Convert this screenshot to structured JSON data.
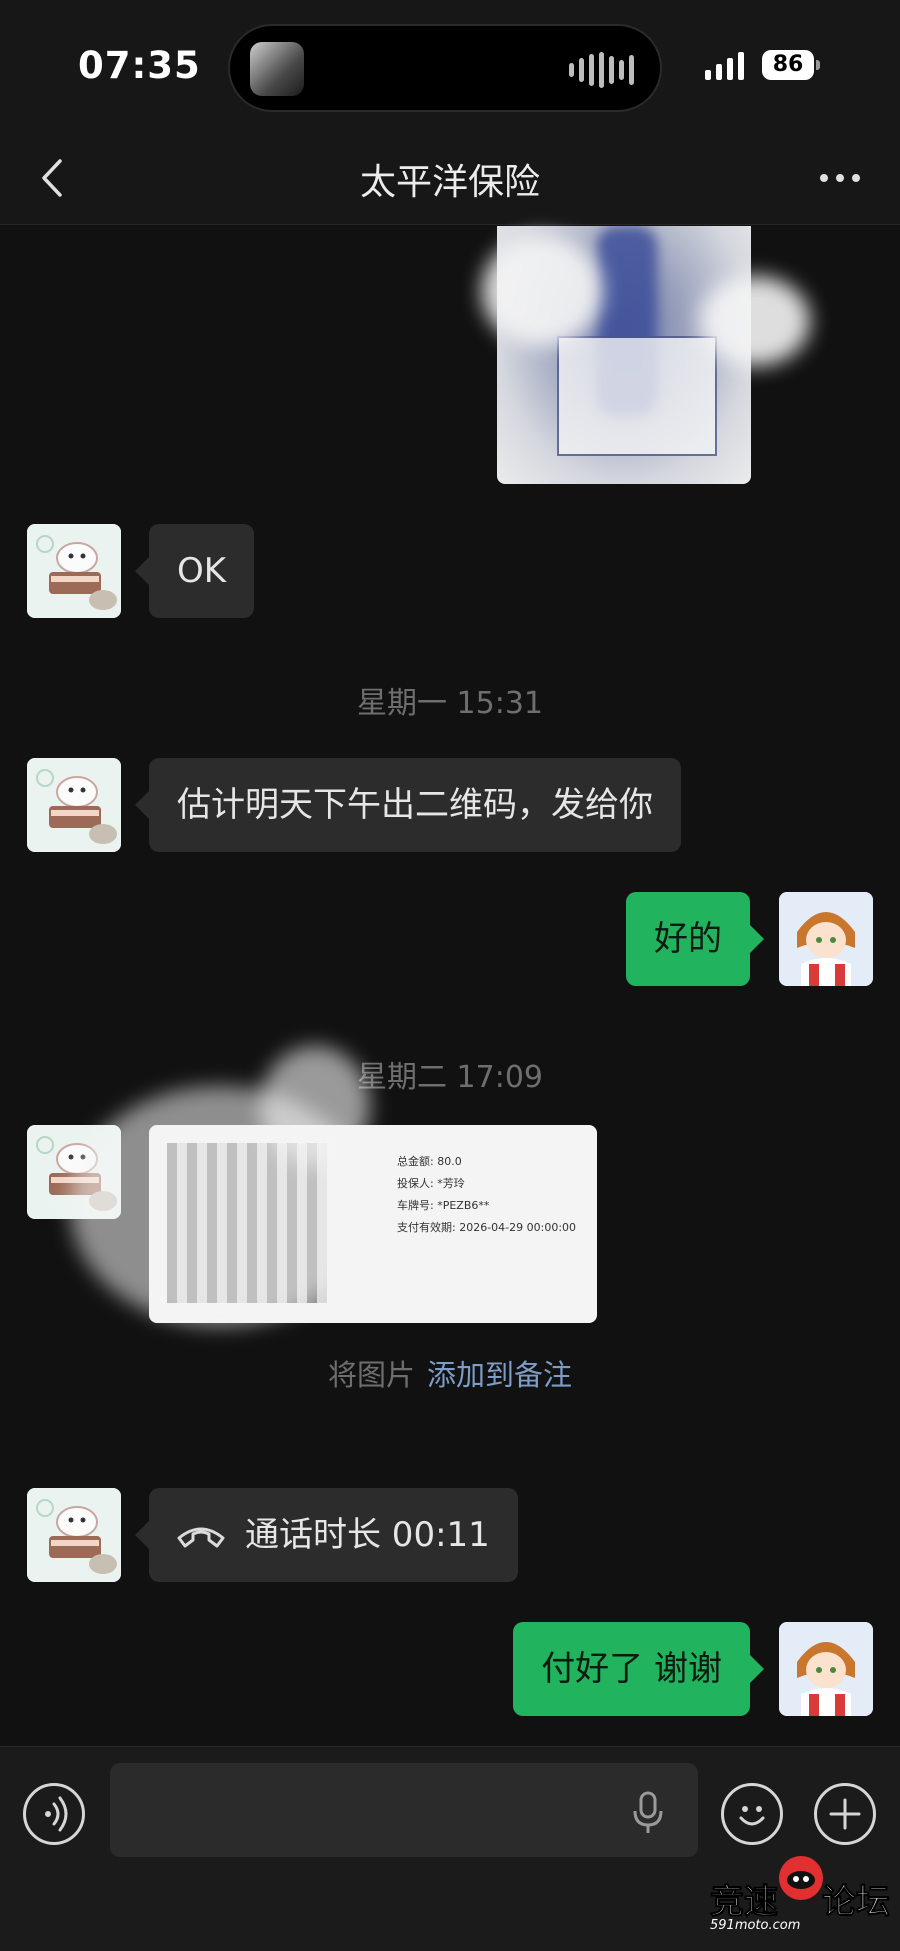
{
  "status_bar": {
    "time": "07:35",
    "battery": "86"
  },
  "nav": {
    "title": "太平洋保险"
  },
  "messages": {
    "ok_text": "OK",
    "timestamp_1": "星期一 15:31",
    "qr_notice": "估计明天下午出二维码，发给你",
    "reply_ok": "好的",
    "timestamp_2": "星期二 17:09",
    "qr_card": {
      "line_1": "总金额: 80.0",
      "line_2": "投保人: *芳玲",
      "line_3": "车牌号: *PEZB6**",
      "line_4": "支付有效期: 2026-04-29 00:00:00"
    },
    "caption_prefix": "将图片",
    "caption_link": "添加到备注",
    "call_text": "通话时长 00:11",
    "reply_paid": "付好了 谢谢"
  },
  "input": {
    "placeholder": ""
  },
  "watermark": {
    "left": "竞速",
    "right": "论坛",
    "domain": "591moto.com"
  },
  "colors": {
    "background": "#111111",
    "incoming_bubble": "#2c2c2c",
    "outgoing_bubble": "#21b35d",
    "link": "#7d9cc7"
  }
}
